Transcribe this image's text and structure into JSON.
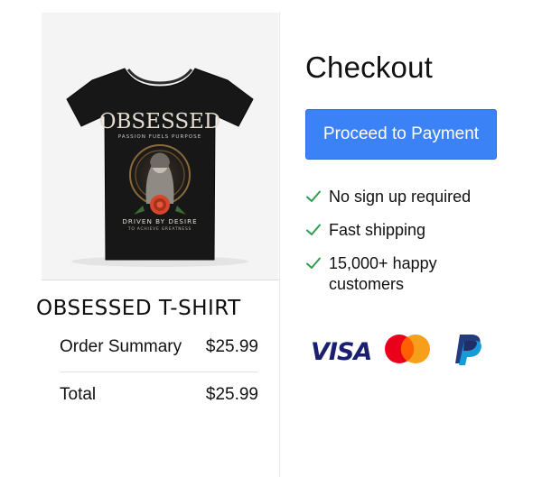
{
  "product": {
    "title": "OBSESSED T-SHIRT",
    "image_alt": "black t-shirt icon",
    "shirt_print": {
      "headline": "OBSESSED",
      "tagline": "PASSION FUELS PURPOSE",
      "slogan": "DRIVEN BY DESIRE",
      "subslogan": "TO ACHIEVE GREATNESS"
    }
  },
  "summary": {
    "order_label": "Order Summary",
    "order_value": "$25.99",
    "total_label": "Total",
    "total_value": "$25.99"
  },
  "checkout": {
    "title": "Checkout",
    "button_label": "Proceed to Payment",
    "features": [
      "No sign up required",
      "Fast shipping",
      "15,000+ happy customers"
    ]
  },
  "payment_methods": [
    "VISA",
    "Mastercard",
    "PayPal"
  ],
  "colors": {
    "button": "#3b82f6",
    "check": "#2e9e4f",
    "visa": "#1a1f71",
    "mc_red": "#eb001b",
    "mc_orange": "#f79e1b",
    "paypal_dark": "#253b80",
    "paypal_light": "#179bd7"
  }
}
